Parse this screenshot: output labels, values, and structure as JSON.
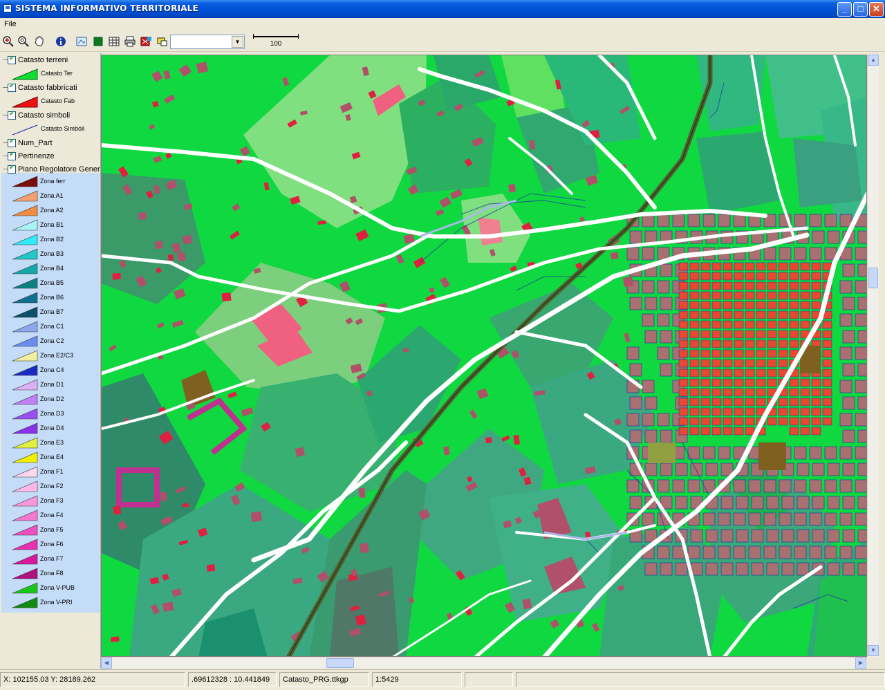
{
  "window": {
    "title": "SISTEMA INFORMATIVO TERRITORIALE",
    "minimize_label": "_",
    "maximize_label": "□",
    "close_label": "✕"
  },
  "menu": {
    "file_label": "File"
  },
  "toolbar": {
    "tools": [
      "zoom-in-icon",
      "zoom-extent-icon",
      "pan-hand-icon",
      "info-icon",
      "map-view-icon",
      "layer-green-icon",
      "grid-table-icon",
      "print-icon",
      "layer-flag-icon",
      "measure-icon"
    ],
    "layer_combo_value": "",
    "scale_bar_label": "100"
  },
  "legend": {
    "layers": [
      {
        "label": "Catasto terreni",
        "checked": true,
        "symbols": [
          {
            "label": "Catasto Ter",
            "type": "polygon",
            "color": "#11dd33"
          }
        ]
      },
      {
        "label": "Catasto fabbricati",
        "checked": true,
        "symbols": [
          {
            "label": "Catasto Fab",
            "type": "polygon",
            "color": "#ee1111"
          }
        ]
      },
      {
        "label": "Catasto simboli",
        "checked": true,
        "symbols": [
          {
            "label": "Catasto Simboli",
            "type": "line",
            "color": "#1a2aa8"
          }
        ]
      },
      {
        "label": "Num_Part",
        "checked": true,
        "symbols": []
      },
      {
        "label": "Pertinenze",
        "checked": true,
        "symbols": []
      },
      {
        "label": "Piano Regolatore Generale",
        "checked": true,
        "symbols": []
      }
    ],
    "zones": [
      {
        "label": "Zona ferr",
        "color": "#7a0c0c"
      },
      {
        "label": "Zona A1",
        "color": "#f2a070"
      },
      {
        "label": "Zona A2",
        "color": "#f28c40"
      },
      {
        "label": "Zona B1",
        "color": "#a8f4f4"
      },
      {
        "label": "Zona B2",
        "color": "#30ecf8"
      },
      {
        "label": "Zona B3",
        "color": "#20c8c8"
      },
      {
        "label": "Zona B4",
        "color": "#15a8a8"
      },
      {
        "label": "Zona B5",
        "color": "#0e8080"
      },
      {
        "label": "Zona B6",
        "color": "#107090"
      },
      {
        "label": "Zona B7",
        "color": "#0c5068"
      },
      {
        "label": "Zona C1",
        "color": "#8ca8ec"
      },
      {
        "label": "Zona C2",
        "color": "#6a8ef0"
      },
      {
        "label": "Zona E2/C3",
        "color": "#f0f0a0"
      },
      {
        "label": "Zona C4",
        "color": "#1a2ac0"
      },
      {
        "label": "Zona D1",
        "color": "#dcb0f4"
      },
      {
        "label": "Zona D2",
        "color": "#c080f4"
      },
      {
        "label": "Zona D3",
        "color": "#9a50f0"
      },
      {
        "label": "Zona D4",
        "color": "#8a30e8"
      },
      {
        "label": "Zona E3",
        "color": "#e0f040"
      },
      {
        "label": "Zona E4",
        "color": "#f0f000"
      },
      {
        "label": "Zona F1",
        "color": "#fcd8f0"
      },
      {
        "label": "Zona F2",
        "color": "#fcb8e8"
      },
      {
        "label": "Zona F3",
        "color": "#f898dc"
      },
      {
        "label": "Zona F4",
        "color": "#f478d0"
      },
      {
        "label": "Zona F5",
        "color": "#f050c0"
      },
      {
        "label": "Zona F6",
        "color": "#e830b0"
      },
      {
        "label": "Zona F7",
        "color": "#d81898"
      },
      {
        "label": "Zona F8",
        "color": "#b01080"
      },
      {
        "label": "Zona V-PUB",
        "color": "#18c818"
      },
      {
        "label": "Zona V-PRI",
        "color": "#108c10"
      }
    ]
  },
  "map": {
    "colors": {
      "background": "#10d840",
      "road": "#ffffff",
      "parcel_dark": "#2ab060",
      "parcel_teal": "#3aa880",
      "parcel_light": "#80e080",
      "building_pink": "#f06080",
      "building_mauve": "#b0506a",
      "urban_block": "#a87070",
      "historic_center": "#e84830",
      "rail": "#506030",
      "cadastral_line": "#1a2aa8"
    }
  },
  "status": {
    "coords": "X: 102155.03 Y: 28189.262",
    "latlon": ".69612328 :  10.441849",
    "project": "Catasto_PRG.ttkgp",
    "scale": "1:5429"
  }
}
